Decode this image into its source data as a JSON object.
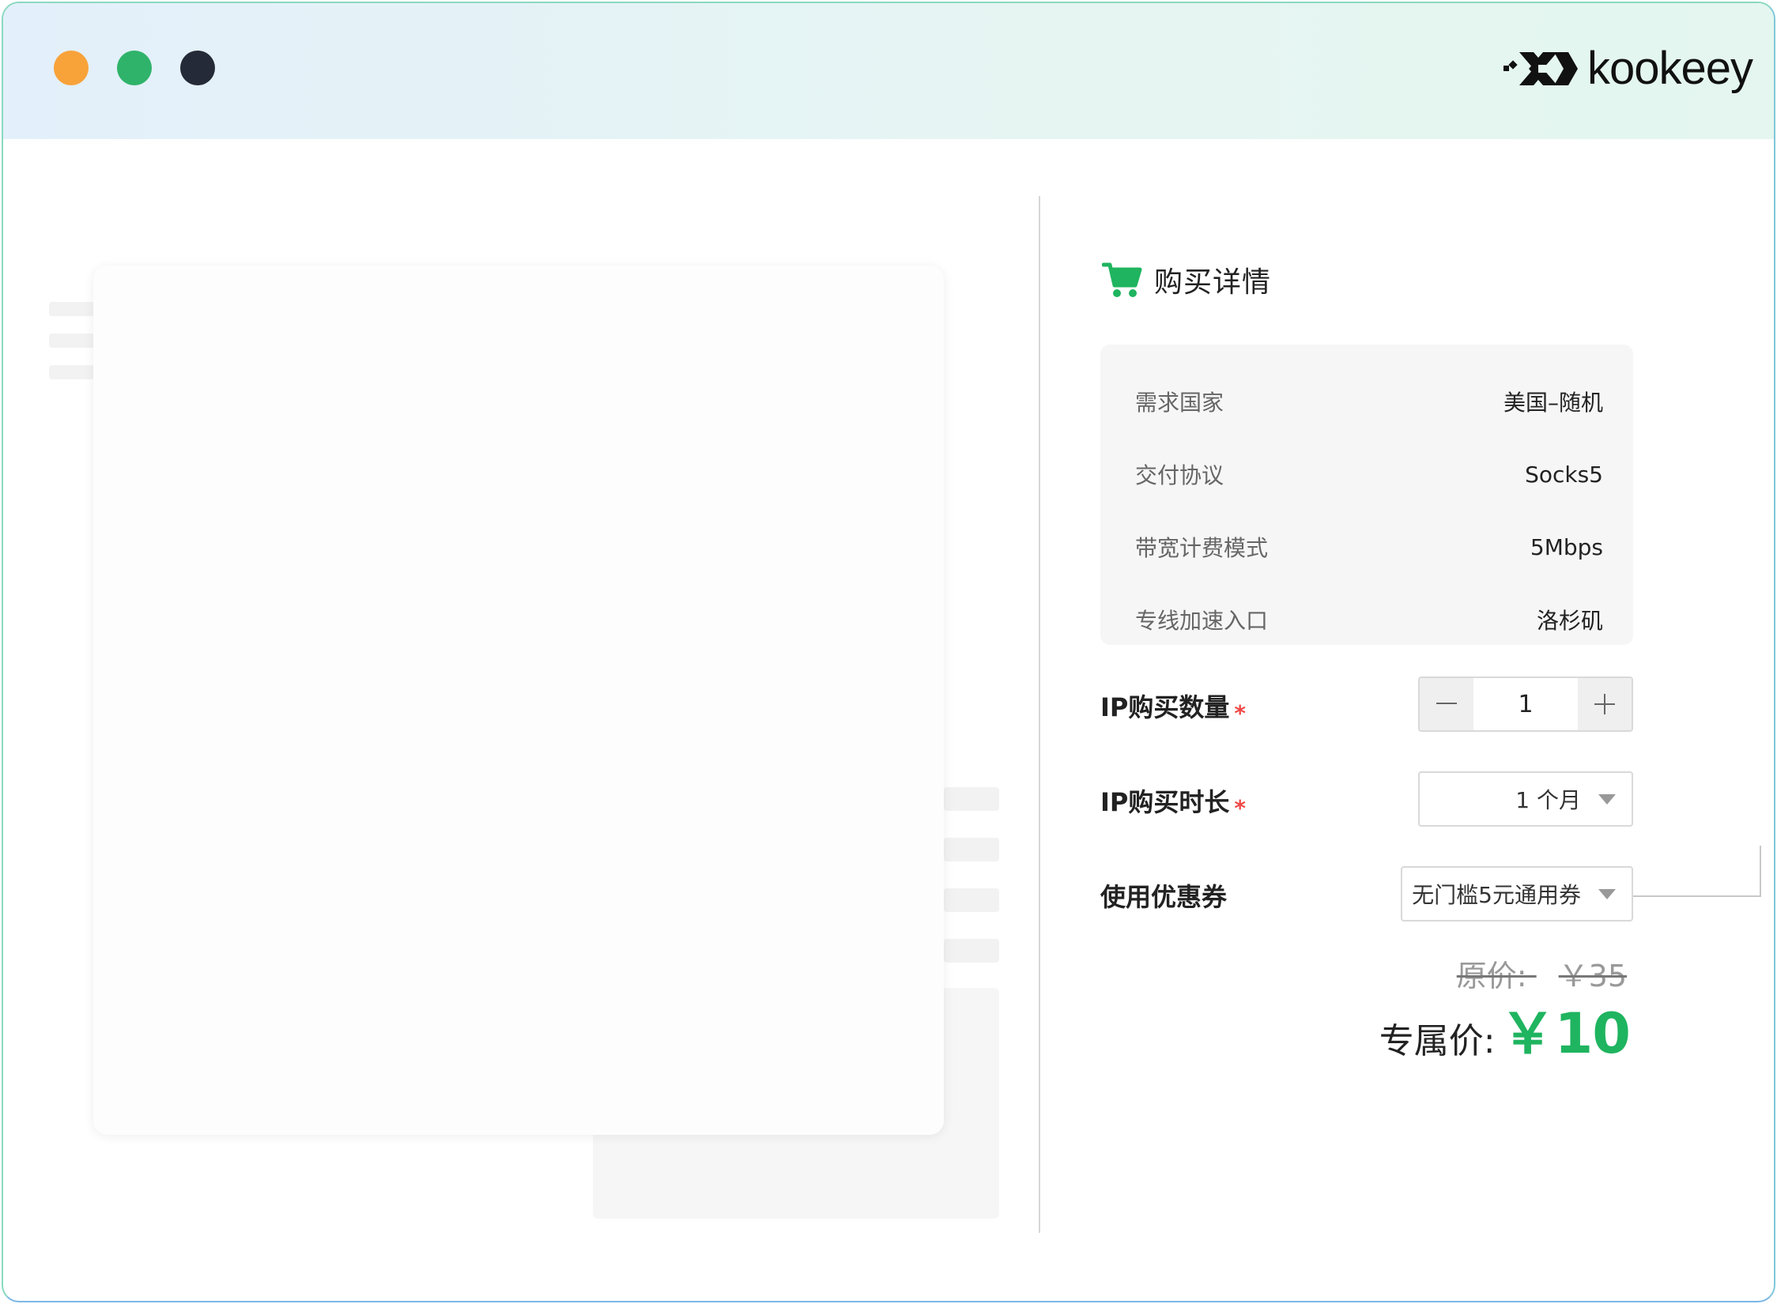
{
  "window": {
    "controls": [
      "close",
      "minimize",
      "maximize"
    ],
    "colors": {
      "close": "#f8a23a",
      "minimize": "#2fb36a",
      "maximize": "#252a38"
    }
  },
  "brand": {
    "logo_text": "kookeey",
    "logo_icon": "kookeey-x-logo-icon"
  },
  "panel": {
    "title": "购买详情",
    "title_icon": "shopping-cart-icon",
    "specs": [
      {
        "label": "需求国家",
        "value": "美国–随机"
      },
      {
        "label": "交付协议",
        "value": "Socks5"
      },
      {
        "label": "带宽计费模式",
        "value": "5Mbps"
      },
      {
        "label": "专线加速入口",
        "value": "洛杉矶"
      }
    ],
    "quantity": {
      "label": "IP购买数量",
      "required_mark": "*",
      "value": "1",
      "minus_icon": "minus-icon",
      "plus_icon": "plus-icon"
    },
    "duration": {
      "label": "IP购买时长",
      "required_mark": "*",
      "selected": "1 个月"
    },
    "coupon": {
      "label": "使用优惠券",
      "selected": "无门槛5元通用券"
    },
    "price": {
      "original_label": "原价:",
      "original_value": "￥35",
      "final_label": "专属价:",
      "final_value": "￥10"
    }
  },
  "colors": {
    "accent": "#1fb45f",
    "required": "#f04848"
  }
}
